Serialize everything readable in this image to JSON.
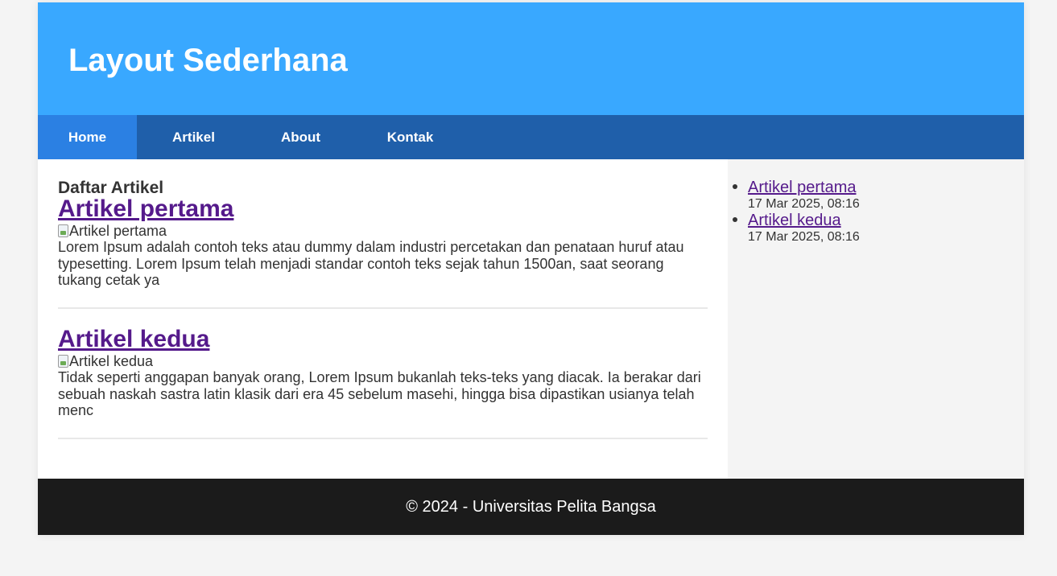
{
  "header": {
    "title": "Layout Sederhana"
  },
  "nav": {
    "items": [
      {
        "label": "Home",
        "active": true
      },
      {
        "label": "Artikel"
      },
      {
        "label": "About"
      },
      {
        "label": "Kontak"
      }
    ]
  },
  "main": {
    "section_title": "Daftar Artikel",
    "articles": [
      {
        "title": "Artikel pertama",
        "image_alt": "Artikel pertama",
        "excerpt": "Lorem Ipsum adalah contoh teks atau dummy dalam industri percetakan dan penataan huruf atau typesetting. Lorem Ipsum telah menjadi standar contoh teks sejak tahun 1500an, saat seorang tukang cetak ya"
      },
      {
        "title": "Artikel kedua",
        "image_alt": "Artikel kedua",
        "excerpt": "Tidak seperti anggapan banyak orang, Lorem Ipsum bukanlah teks-teks yang diacak. Ia berakar dari sebuah naskah sastra latin klasik dari era 45 sebelum masehi, hingga bisa dipastikan usianya telah menc"
      }
    ]
  },
  "sidebar": {
    "items": [
      {
        "title": "Artikel pertama",
        "date": "17 Mar 2025, 08:16"
      },
      {
        "title": "Artikel kedua",
        "date": "17 Mar 2025, 08:16"
      }
    ]
  },
  "footer": {
    "text": "© 2024 - Universitas Pelita Bangsa"
  },
  "colors": {
    "header_bg": "#39a8ff",
    "nav_bg": "#1f5faa",
    "nav_active": "#2b80e3",
    "link": "#551a8b",
    "footer_bg": "#1b1b1b"
  }
}
